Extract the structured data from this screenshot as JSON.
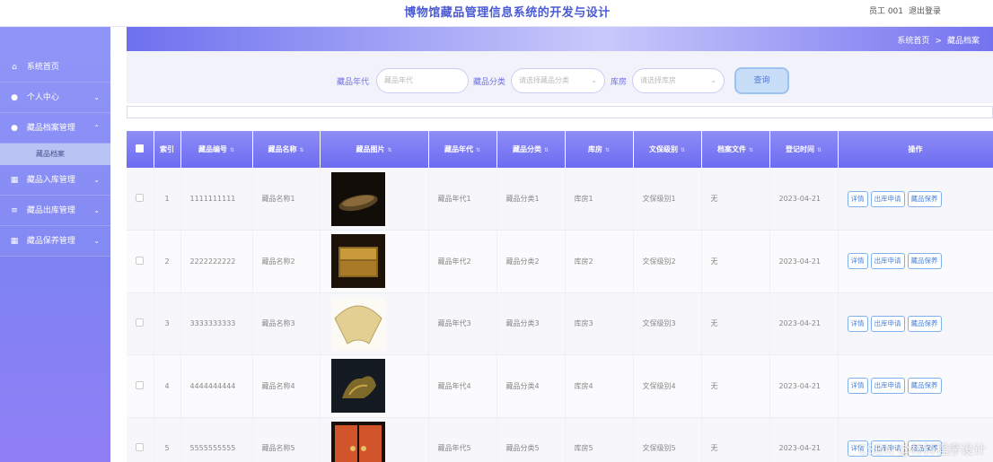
{
  "app": {
    "title": "博物馆藏品管理信息系统的开发与设计",
    "user": "员工 001",
    "logout": "退出登录"
  },
  "sidebar": {
    "items": [
      {
        "label": "系统首页",
        "icon": "home-icon"
      },
      {
        "label": "个人中心",
        "icon": "user-icon"
      },
      {
        "label": "藏品档案管理",
        "icon": "user-icon"
      },
      {
        "label": "藏品档案",
        "sub": true
      },
      {
        "label": "藏品入库管理",
        "icon": "grid-icon"
      },
      {
        "label": "藏品出库管理",
        "icon": "list-icon"
      },
      {
        "label": "藏品保养管理",
        "icon": "grid-icon"
      }
    ]
  },
  "breadcrumb": {
    "home": "系统首页",
    "sep": ">",
    "current": "藏品档案"
  },
  "search": {
    "era_label": "藏品年代",
    "era_placeholder": "藏品年代",
    "category_label": "藏品分类",
    "category_placeholder": "请选择藏品分类",
    "warehouse_label": "库房",
    "warehouse_placeholder": "请选择库房",
    "query_button": "查询"
  },
  "table": {
    "headers": {
      "index": "索引",
      "code": "藏品编号",
      "name": "藏品名称",
      "image": "藏品图片",
      "era": "藏品年代",
      "category": "藏品分类",
      "warehouse": "库房",
      "level": "文保级别",
      "file": "档案文件",
      "date": "登记时间",
      "actions": "操作"
    },
    "rows": [
      {
        "index": "1",
        "code": "1111111111",
        "name": "藏品名称1",
        "era": "藏品年代1",
        "category": "藏品分类1",
        "warehouse": "库房1",
        "level": "文保级别1",
        "file": "无",
        "date": "2023-04-21"
      },
      {
        "index": "2",
        "code": "2222222222",
        "name": "藏品名称2",
        "era": "藏品年代2",
        "category": "藏品分类2",
        "warehouse": "库房2",
        "level": "文保级别2",
        "file": "无",
        "date": "2023-04-21"
      },
      {
        "index": "3",
        "code": "3333333333",
        "name": "藏品名称3",
        "era": "藏品年代3",
        "category": "藏品分类3",
        "warehouse": "库房3",
        "level": "文保级别3",
        "file": "无",
        "date": "2023-04-21"
      },
      {
        "index": "4",
        "code": "4444444444",
        "name": "藏品名称4",
        "era": "藏品年代4",
        "category": "藏品分类4",
        "warehouse": "库房4",
        "level": "文保级别4",
        "file": "无",
        "date": "2023-04-21"
      },
      {
        "index": "5",
        "code": "5555555555",
        "name": "藏品名称5",
        "era": "藏品年代5",
        "category": "藏品分类5",
        "warehouse": "库房5",
        "level": "文保级别5",
        "file": "无",
        "date": "2023-04-21"
      }
    ],
    "actions": {
      "detail": "详情",
      "outbound": "出库申请",
      "maintain": "藏品保养"
    }
  },
  "watermark": "CSDN @林科程序设计",
  "colors": {
    "accent": "#6c6cf1",
    "sidebar": "#8a90f8",
    "title": "#4a5ad6"
  }
}
